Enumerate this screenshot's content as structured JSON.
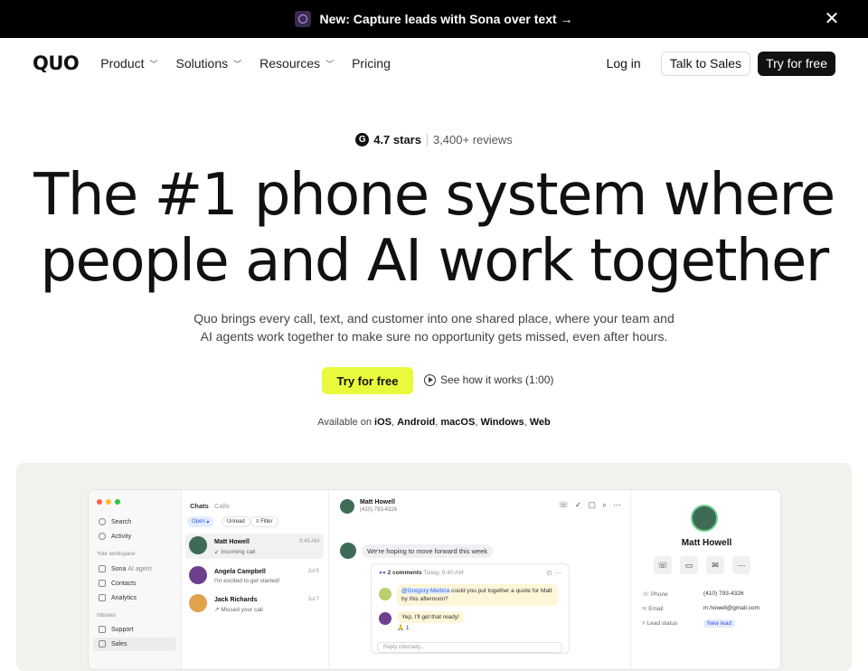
{
  "banner": {
    "text": "New: Capture leads with Sona over text →",
    "close": "✕"
  },
  "nav": {
    "logo": "QUO",
    "items": [
      {
        "label": "Product",
        "dropdown": true
      },
      {
        "label": "Solutions",
        "dropdown": true
      },
      {
        "label": "Resources",
        "dropdown": true
      },
      {
        "label": "Pricing",
        "dropdown": false
      }
    ],
    "login": "Log in",
    "talk": "Talk to Sales",
    "try": "Try for free"
  },
  "rating": {
    "icon": "G",
    "stars": "4.7 stars",
    "reviews": "3,400+ reviews"
  },
  "hero": {
    "line1": "The #1 phone system where",
    "line2": "people and AI work together",
    "sub1": "Quo brings every call, text, and customer into one shared place, where your team and",
    "sub2": "AI agents work together to make sure no opportunity gets missed, even after hours.",
    "cta": "Try for free",
    "howit": "See how it works (1:00)",
    "avail_prefix": "Available on",
    "platforms": [
      "iOS",
      "Android",
      "macOS",
      "Windows",
      "Web"
    ]
  },
  "app": {
    "sidebar": {
      "items": [
        "Search",
        "Activity"
      ],
      "workspace_head": "Your workspace",
      "workspace": [
        {
          "label": "Sona",
          "badge": "AI agent"
        },
        {
          "label": "Contacts"
        },
        {
          "label": "Analytics"
        }
      ],
      "inbox_head": "Inboxes",
      "inboxes": [
        "Support",
        "Sales"
      ]
    },
    "list": {
      "tabs": [
        "Chats",
        "Calls"
      ],
      "filters": [
        "Open",
        "Unread",
        "Filter"
      ],
      "rows": [
        {
          "name": "Matt Howell",
          "preview": "Incoming call",
          "time": "9:45 AM"
        },
        {
          "name": "Angela Campbell",
          "preview": "I'm excited to get started!",
          "time": "Jul 5"
        },
        {
          "name": "Jack Richards",
          "preview": "Missed your call",
          "time": "Jul 7"
        }
      ]
    },
    "chat": {
      "name": "Matt Howell",
      "phone": "(410) 793-4326",
      "message": "We're hoping to move forward this week",
      "comments_head": "2 comments",
      "comments_time": "Today, 9:40 AM",
      "mention": "@Gregory Medina",
      "comment1": "could you put together a quote for Matt by this afternoon?",
      "comment2": "Yep, I'll get that ready!",
      "reaction": "🙏 1",
      "reply_placeholder": "Reply internally..."
    },
    "contact": {
      "name": "Matt Howell",
      "fields": [
        {
          "label": "Phone",
          "value": "(410) 793-4326"
        },
        {
          "label": "Email",
          "value": "m.howell@gmail.com"
        },
        {
          "label": "Lead status",
          "value": "New lead"
        }
      ]
    }
  }
}
